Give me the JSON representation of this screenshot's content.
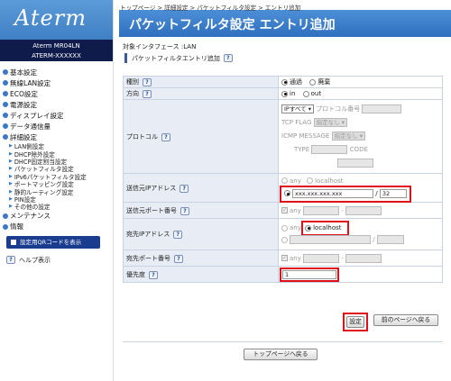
{
  "sidebar": {
    "logo": "Aterm",
    "model_line1": "Aterm MR04LN",
    "model_line2": "ATERM-XXXXXX",
    "items": [
      "基本設定",
      "無線LAN設定",
      "ECO設定",
      "電源設定",
      "ディスプレイ設定",
      "データ通信量",
      "詳細設定"
    ],
    "subitems": [
      "LAN側設定",
      "DHCP除外設定",
      "DHCP固定割当設定",
      "パケットフィルタ設定",
      "IPv6パケットフィルタ設定",
      "ポートマッピング設定",
      "静的ルーティング設定",
      "PIN設定",
      "その他の設定"
    ],
    "items_after": [
      "メンテナンス",
      "情報"
    ],
    "qr_button": "設定用QRコードを表示",
    "help": "ヘルプ表示"
  },
  "breadcrumb": "トップページ > 詳細設定 > パケットフィルタ設定 > エントリ追加",
  "page_title": "パケットフィルタ設定 エントリ追加",
  "interface_line": "対象インタフェース :LAN",
  "section_title": "パケットフィルタエントリ追加",
  "help_mark": "?",
  "form": {
    "type": {
      "label": "種別",
      "pass": "通過",
      "discard": "廃棄"
    },
    "direction": {
      "label": "方向",
      "in": "in",
      "out": "out"
    },
    "protocol": {
      "label": "プロトコル",
      "select": "IPすべて",
      "proto_num_label": "プロトコル番号",
      "tcp_flag_label": "TCP FLAG",
      "tcp_flag_value": "指定なし",
      "icmp_label": "ICMP MESSAGE",
      "icmp_value": "指定なし",
      "type_label": "TYPE",
      "code_label": "CODE"
    },
    "src_ip": {
      "label": "送信元IPアドレス",
      "any": "any",
      "localhost": "localhost",
      "address": "xxx.xxx.xxx.xxx",
      "slash": "/",
      "mask": "32"
    },
    "src_port": {
      "label": "送信元ポート番号",
      "any": "any",
      "dash": "-"
    },
    "dst_ip": {
      "label": "宛先IPアドレス",
      "any": "any",
      "localhost": "localhost",
      "slash": "/"
    },
    "dst_port": {
      "label": "宛先ポート番号",
      "any": "any",
      "dash": "-"
    },
    "priority": {
      "label": "優先度",
      "value": "1"
    }
  },
  "buttons": {
    "save": "設定",
    "back": "前のページへ戻る",
    "top": "トップページへ戻る"
  }
}
